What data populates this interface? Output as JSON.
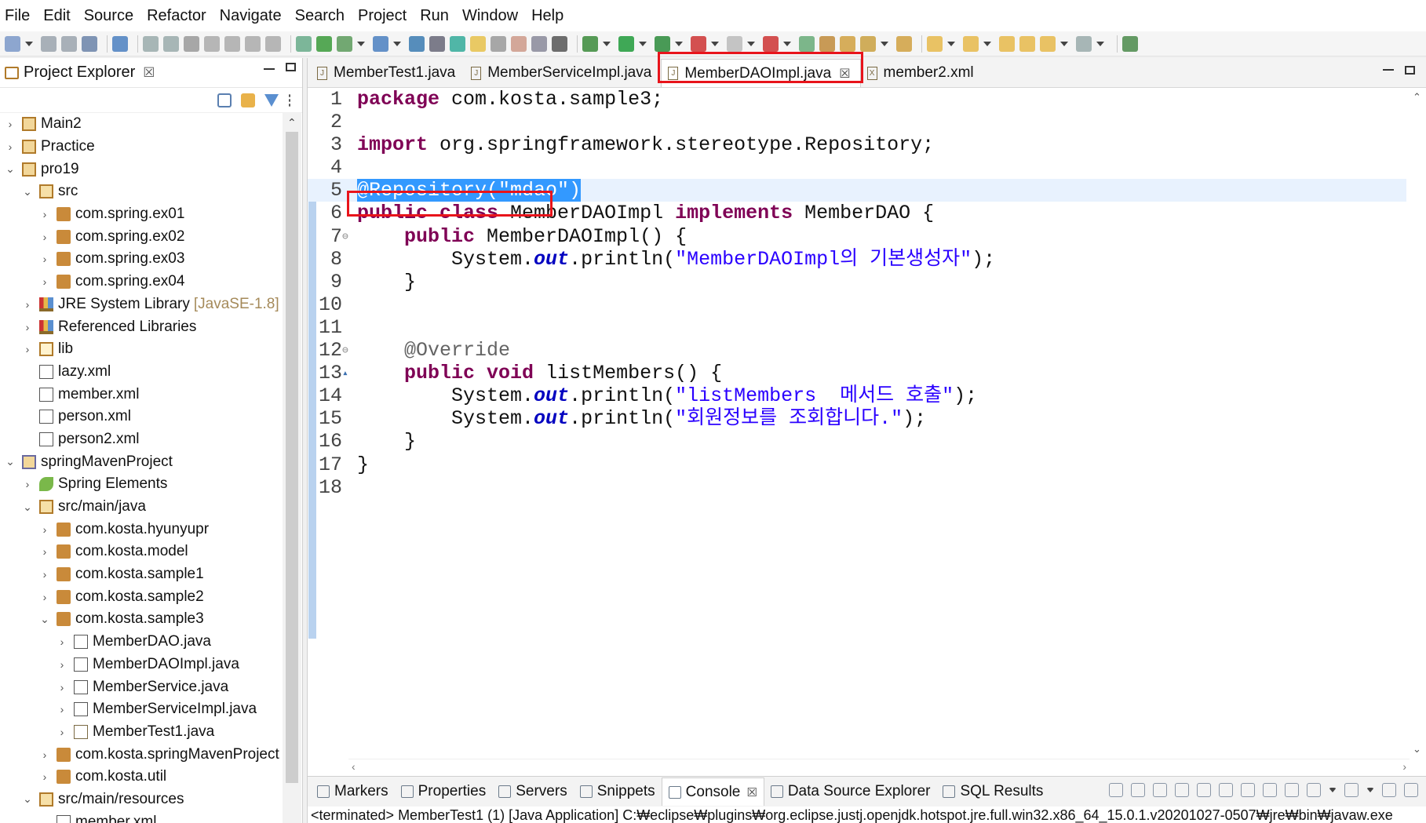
{
  "menu": [
    "File",
    "Edit",
    "Source",
    "Refactor",
    "Navigate",
    "Search",
    "Project",
    "Run",
    "Window",
    "Help"
  ],
  "explorer": {
    "title": "Project Explorer",
    "close": "☒",
    "tree": [
      {
        "indent": 0,
        "chev": "›",
        "icon": "project-icon",
        "label": "Main2"
      },
      {
        "indent": 0,
        "chev": "›",
        "icon": "project-icon",
        "label": "Practice"
      },
      {
        "indent": 0,
        "chev": "⌄",
        "icon": "project-icon",
        "label": "pro19"
      },
      {
        "indent": 1,
        "chev": "⌄",
        "icon": "source-folder-icon",
        "label": "src"
      },
      {
        "indent": 2,
        "chev": "›",
        "icon": "package-icon",
        "label": "com.spring.ex01"
      },
      {
        "indent": 2,
        "chev": "›",
        "icon": "package-icon",
        "label": "com.spring.ex02"
      },
      {
        "indent": 2,
        "chev": "›",
        "icon": "package-icon",
        "label": "com.spring.ex03"
      },
      {
        "indent": 2,
        "chev": "›",
        "icon": "package-icon",
        "label": "com.spring.ex04"
      },
      {
        "indent": 1,
        "chev": "›",
        "icon": "library-icon",
        "label": "JRE System Library",
        "deco": "[JavaSE-1.8]"
      },
      {
        "indent": 1,
        "chev": "›",
        "icon": "library-icon",
        "label": "Referenced Libraries"
      },
      {
        "indent": 1,
        "chev": "›",
        "icon": "folder-icon",
        "label": "lib"
      },
      {
        "indent": 1,
        "chev": "",
        "icon": "xml-file-icon",
        "label": "lazy.xml"
      },
      {
        "indent": 1,
        "chev": "",
        "icon": "xml-file-icon",
        "label": "member.xml"
      },
      {
        "indent": 1,
        "chev": "",
        "icon": "xml-file-icon",
        "label": "person.xml"
      },
      {
        "indent": 1,
        "chev": "",
        "icon": "xml-file-icon",
        "label": "person2.xml"
      },
      {
        "indent": 0,
        "chev": "⌄",
        "icon": "maven-project-icon",
        "label": "springMavenProject"
      },
      {
        "indent": 1,
        "chev": "›",
        "icon": "spring-elements-icon",
        "label": "Spring Elements"
      },
      {
        "indent": 1,
        "chev": "⌄",
        "icon": "source-folder-icon",
        "label": "src/main/java"
      },
      {
        "indent": 2,
        "chev": "›",
        "icon": "package-icon",
        "label": "com.kosta.hyunyupr"
      },
      {
        "indent": 2,
        "chev": "›",
        "icon": "package-icon",
        "label": "com.kosta.model"
      },
      {
        "indent": 2,
        "chev": "›",
        "icon": "package-icon",
        "label": "com.kosta.sample1"
      },
      {
        "indent": 2,
        "chev": "›",
        "icon": "package-icon",
        "label": "com.kosta.sample2"
      },
      {
        "indent": 2,
        "chev": "⌄",
        "icon": "package-icon",
        "label": "com.kosta.sample3"
      },
      {
        "indent": 3,
        "chev": "›",
        "icon": "interface-file-icon",
        "label": "MemberDAO.java"
      },
      {
        "indent": 3,
        "chev": "›",
        "icon": "spring-java-file-icon",
        "label": "MemberDAOImpl.java"
      },
      {
        "indent": 3,
        "chev": "›",
        "icon": "interface-file-icon",
        "label": "MemberService.java"
      },
      {
        "indent": 3,
        "chev": "›",
        "icon": "spring-java-file-icon",
        "label": "MemberServiceImpl.java"
      },
      {
        "indent": 3,
        "chev": "›",
        "icon": "java-file-icon",
        "label": "MemberTest1.java"
      },
      {
        "indent": 2,
        "chev": "›",
        "icon": "package-icon",
        "label": "com.kosta.springMavenProject"
      },
      {
        "indent": 2,
        "chev": "›",
        "icon": "package-icon",
        "label": "com.kosta.util"
      },
      {
        "indent": 1,
        "chev": "⌄",
        "icon": "source-folder-icon",
        "label": "src/main/resources"
      },
      {
        "indent": 2,
        "chev": "",
        "icon": "xml-file-icon",
        "label": "member.xml"
      }
    ]
  },
  "editor": {
    "tabs": [
      {
        "label": "MemberTest1.java",
        "type": "J",
        "active": false
      },
      {
        "label": "MemberServiceImpl.java",
        "type": "J",
        "active": false
      },
      {
        "label": "MemberDAOImpl.java",
        "type": "J",
        "active": true,
        "close": "☒"
      },
      {
        "label": "member2.xml",
        "type": "X",
        "active": false
      }
    ],
    "lines": [
      {
        "n": "1",
        "code": "package com.kosta.sample3;"
      },
      {
        "n": "2",
        "code": ""
      },
      {
        "n": "3",
        "code": "import org.springframework.stereotype.Repository;"
      },
      {
        "n": "4",
        "code": ""
      },
      {
        "n": "5",
        "code": "@Repository(\"mdao\")"
      },
      {
        "n": "6",
        "code": "public class MemberDAOImpl implements MemberDAO {"
      },
      {
        "n": "7",
        "code": "    public MemberDAOImpl() {"
      },
      {
        "n": "8",
        "code": "        System.out.println(\"MemberDAOImpl의 기본생성자\");"
      },
      {
        "n": "9",
        "code": "    }"
      },
      {
        "n": "10",
        "code": ""
      },
      {
        "n": "11",
        "code": ""
      },
      {
        "n": "12",
        "code": "    @Override"
      },
      {
        "n": "13",
        "code": "    public void listMembers() {"
      },
      {
        "n": "14",
        "code": "        System.out.println(\"listMembers  메서드 호출\");"
      },
      {
        "n": "15",
        "code": "        System.out.println(\"회원정보를 조회합니다.\");"
      },
      {
        "n": "16",
        "code": "    }"
      },
      {
        "n": "17",
        "code": "}"
      },
      {
        "n": "18",
        "code": ""
      }
    ]
  },
  "bottom": {
    "tabs": [
      {
        "label": "Markers",
        "active": false
      },
      {
        "label": "Properties",
        "active": false
      },
      {
        "label": "Servers",
        "active": false
      },
      {
        "label": "Snippets",
        "active": false
      },
      {
        "label": "Console",
        "active": true,
        "close": "☒"
      },
      {
        "label": "Data Source Explorer",
        "active": false
      },
      {
        "label": "SQL Results",
        "active": false
      }
    ],
    "console_text": "<terminated> MemberTest1 (1) [Java Application] C:₩eclipse₩plugins₩org.eclipse.justj.openjdk.hotspot.jre.full.win32.x86_64_15.0.1.v20201027-0507₩jre₩bin₩javaw.exe"
  },
  "colors": {
    "keyword": "#7f0055",
    "string": "#2a00ff",
    "field": "#0000c0",
    "highlight": "#e8141b",
    "selection": "#3399ff"
  }
}
